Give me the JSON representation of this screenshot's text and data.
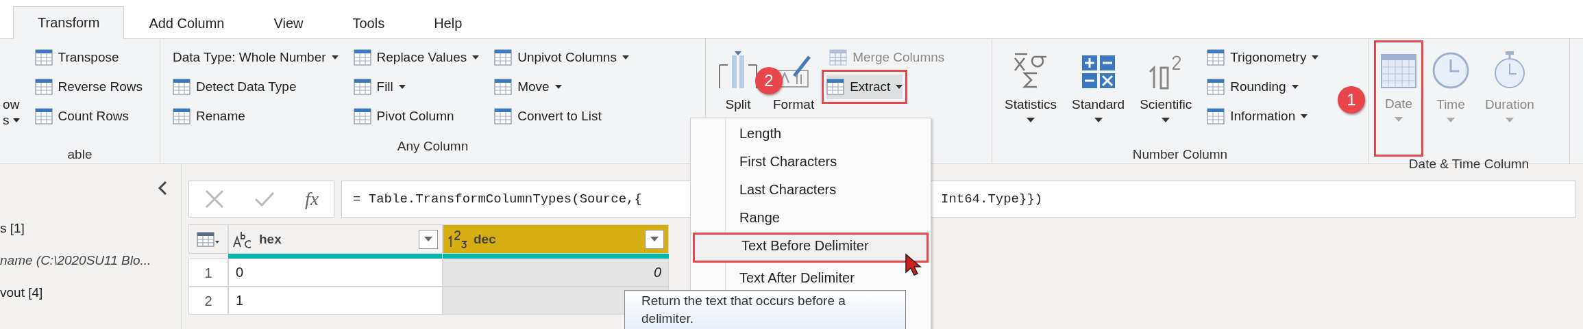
{
  "tabs": [
    {
      "label": "Transform",
      "selected": true
    },
    {
      "label": "Add Column",
      "selected": false
    },
    {
      "label": "View",
      "selected": false
    },
    {
      "label": "Tools",
      "selected": false
    },
    {
      "label": "Help",
      "selected": false
    }
  ],
  "ribbon": {
    "groups": [
      {
        "label": "able",
        "columns": [
          {
            "kind": "big",
            "items": [
              {
                "lines": [
                  "ow",
                  "s"
                ],
                "dropdown": true,
                "disabled": false
              }
            ]
          },
          {
            "kind": "small",
            "items": [
              {
                "label": "Transpose",
                "dropdown": false,
                "disabled": false
              },
              {
                "label": "Reverse Rows",
                "dropdown": false,
                "disabled": false
              },
              {
                "label": "Count Rows",
                "dropdown": false,
                "disabled": false
              }
            ]
          }
        ]
      },
      {
        "label": "Any Column",
        "columns": [
          {
            "kind": "small",
            "items": [
              {
                "label": "Data Type: Whole Number",
                "dropdown": true,
                "disabled": false
              },
              {
                "label": "Detect Data Type",
                "dropdown": false,
                "disabled": false
              },
              {
                "label": "Rename",
                "dropdown": false,
                "disabled": false
              }
            ]
          },
          {
            "kind": "small",
            "items": [
              {
                "label": "Replace Values",
                "dropdown": true,
                "disabled": false
              },
              {
                "label": "Fill",
                "dropdown": true,
                "disabled": false
              },
              {
                "label": "Pivot Column",
                "dropdown": false,
                "disabled": false
              }
            ]
          },
          {
            "kind": "small",
            "items": [
              {
                "label": "Unpivot Columns",
                "dropdown": true,
                "disabled": false
              },
              {
                "label": "Move",
                "dropdown": true,
                "disabled": false
              },
              {
                "label": "Convert to List",
                "dropdown": false,
                "disabled": false
              }
            ]
          }
        ]
      },
      {
        "columns": [
          {
            "kind": "big",
            "items": [
              {
                "lines": [
                  "Split"
                ],
                "disabled": false
              }
            ]
          },
          {
            "kind": "big",
            "items": [
              {
                "lines": [
                  "Format"
                ],
                "disabled": false
              }
            ]
          },
          {
            "kind": "small",
            "items": [
              {
                "label": "Merge Columns",
                "dropdown": false,
                "disabled": true
              },
              {
                "label": "Extract",
                "dropdown": true,
                "disabled": false,
                "pressed": true,
                "framed": true
              }
            ]
          }
        ]
      },
      {
        "label": "Number Column",
        "columns": [
          {
            "kind": "big",
            "items": [
              {
                "lines": [
                  "Statistics"
                ],
                "dropdown": true,
                "disabled": false
              }
            ]
          },
          {
            "kind": "big",
            "items": [
              {
                "lines": [
                  "Standard"
                ],
                "dropdown": true,
                "disabled": false
              }
            ]
          },
          {
            "kind": "big",
            "items": [
              {
                "lines": [
                  "Scientific"
                ],
                "dropdown": true,
                "disabled": false
              }
            ]
          },
          {
            "kind": "small",
            "items": [
              {
                "label": "Trigonometry",
                "dropdown": true,
                "disabled": false
              },
              {
                "label": "Rounding",
                "dropdown": true,
                "disabled": false
              },
              {
                "label": "Information",
                "dropdown": true,
                "disabled": false
              }
            ]
          }
        ]
      },
      {
        "label": "Date & Time Column",
        "columns": [
          {
            "kind": "big",
            "items": [
              {
                "lines": [
                  "Date"
                ],
                "dropdown": true,
                "disabled": true,
                "framed": true
              }
            ]
          },
          {
            "kind": "big",
            "items": [
              {
                "lines": [
                  "Time"
                ],
                "dropdown": true,
                "disabled": true
              }
            ]
          },
          {
            "kind": "big",
            "items": [
              {
                "lines": [
                  "Duration"
                ],
                "dropdown": true,
                "disabled": true
              }
            ]
          }
        ]
      }
    ]
  },
  "badges": [
    {
      "text": "2"
    },
    {
      "text": "1"
    }
  ],
  "queries": [
    {
      "label": "s [1]",
      "kind": "plain"
    },
    {
      "label": "name (C:\\2020SU11 Blo...",
      "kind": "italic"
    },
    {
      "label": "vout [4]",
      "kind": "plain"
    }
  ],
  "formula_bar": {
    "fx": "fx",
    "parts": [
      "= Table.TransformColumnTypes(Source,{",
      "Int64.Type}})"
    ]
  },
  "table": {
    "columns": [
      {
        "name": "hex",
        "selected": false
      },
      {
        "name": "dec",
        "selected": true
      }
    ],
    "rows": [
      {
        "number": "1",
        "cells": [
          "0",
          "0"
        ]
      },
      {
        "number": "2",
        "cells": [
          "1",
          null
        ]
      }
    ]
  },
  "menu": {
    "items": [
      {
        "label": "Length",
        "selected": false
      },
      {
        "label": "First Characters",
        "selected": false
      },
      {
        "label": "Last Characters",
        "selected": false
      },
      {
        "label": "Range",
        "selected": false
      },
      {
        "label": "Text Before Delimiter",
        "selected": true,
        "framed": true
      },
      {
        "label": "Text After Delimiter",
        "selected": false
      }
    ]
  },
  "tooltip": "Return the text that occurs before a delimiter."
}
